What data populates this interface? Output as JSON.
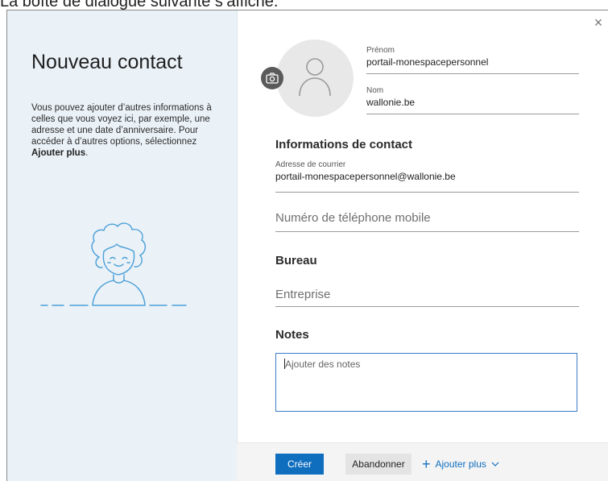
{
  "caption": "La boîte de dialogue suivante s’affiche.",
  "dialog": {
    "title": "Nouveau contact",
    "description_parts": [
      "Vous pouvez ajouter d’autres informations à celles que vous voyez ici, par exemple, une adresse et une date d’anniversaire. Pour accéder à d’autres options, sélectionnez ",
      "Ajouter plus",
      "."
    ],
    "close_icon": "close-icon",
    "close_glyph": "×"
  },
  "name_fields": {
    "first_name_label": "Prénom",
    "first_name_value": "portail-monespacepersonnel",
    "last_name_label": "Nom",
    "last_name_value": "wallonie.be"
  },
  "contact_info": {
    "title": "Informations de contact",
    "email_label": "Adresse de courrier",
    "email_value": "portail-monespacepersonnel@wallonie.be",
    "phone_placeholder": "Numéro de téléphone mobile"
  },
  "office": {
    "title": "Bureau",
    "company_placeholder": "Entreprise"
  },
  "notes": {
    "title": "Notes",
    "placeholder": "Ajouter des notes"
  },
  "footer": {
    "create_label": "Créer",
    "cancel_label": "Abandonner",
    "add_more_label": "Ajouter plus",
    "plus_glyph": "+"
  },
  "colors": {
    "accent": "#106ebe",
    "left_pane": "#eaf1f7",
    "notes_border": "#3a7bc8"
  }
}
